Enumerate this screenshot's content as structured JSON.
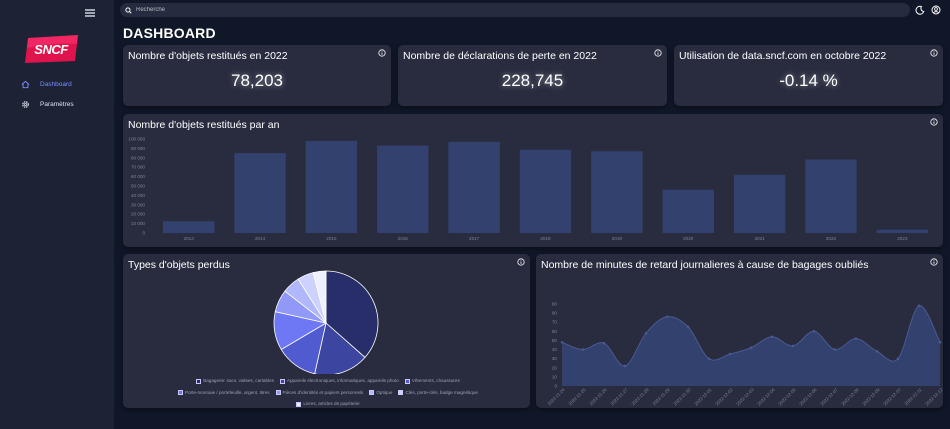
{
  "app": {
    "brand": "SNCF",
    "colors": {
      "accent": "#7b8cff",
      "background": "#101728",
      "sidebar": "#1d2335",
      "card": "#282c3e",
      "bar": "#33416e",
      "line_area": "#33416e",
      "logo_red": "#e0144c"
    }
  },
  "sidebar": {
    "items": [
      {
        "label": "Dashboard",
        "icon": "home-icon",
        "active": true
      },
      {
        "label": "Paramètres",
        "icon": "gear-icon",
        "active": false
      }
    ]
  },
  "search": {
    "placeholder": "Recherche"
  },
  "page": {
    "title": "DASHBOARD"
  },
  "kpis": [
    {
      "title": "Nombre d'objets restitués en 2022",
      "value": "78,203"
    },
    {
      "title": "Nombre de déclarations de perte en 2022",
      "value": "228,745"
    },
    {
      "title": "Utilisation de data.sncf.com en octobre 2022",
      "value": "-0.14 %"
    }
  ],
  "charts": {
    "bar_title": "Nombre d'objets restitués par an",
    "pie_title": "Types d'objets perdus",
    "line_title": "Nombre de minutes de retard journalieres à cause de bagages oubliés"
  },
  "chart_data": [
    {
      "type": "bar",
      "categories": [
        "2013",
        "2014",
        "2015",
        "2016",
        "2017",
        "2018",
        "2019",
        "2020",
        "2021",
        "2022",
        "2023"
      ],
      "values": [
        12500,
        85000,
        98000,
        93000,
        97000,
        88500,
        87000,
        46000,
        62000,
        78203,
        3500
      ],
      "yticks": [
        "0",
        "10 000",
        "20 000",
        "30 000",
        "40 000",
        "50 000",
        "60 000",
        "70 000",
        "80 000",
        "90 000",
        "100 000"
      ],
      "ylim": [
        0,
        100000
      ],
      "grid": false
    },
    {
      "type": "pie",
      "labels": [
        "Bagagerie: sacs, valises, cartables",
        "Appareils électroniques, informatiques, appareils photo",
        "Vêtements, chaussures",
        "Porte-monnaie / portefeuille, argent, titres",
        "Pièces d'identités et papiers personnels",
        "Optique",
        "Clés, porte-clés, badge magnétique",
        "Livres, articles de papèterie"
      ],
      "values": [
        36.5,
        17,
        13,
        12,
        7,
        5.5,
        5,
        4
      ],
      "colors": [
        "#272e6a",
        "#3c46a0",
        "#515bd0",
        "#6e78f5",
        "#9098f8",
        "#b1b7fb",
        "#cdd1fd",
        "#eeefff"
      ],
      "legend": "bottom"
    },
    {
      "type": "area",
      "x": [
        "2022-11-24",
        "2022-11-25",
        "2022-11-26",
        "2022-11-27",
        "2022-11-28",
        "2022-11-29",
        "2022-11-30",
        "2022-12-01",
        "2022-12-02",
        "2022-12-03",
        "2022-12-04",
        "2022-12-05",
        "2022-12-06",
        "2022-12-07",
        "2022-12-08",
        "2022-12-09",
        "2022-12-10",
        "2022-12-11",
        "2022-12-12"
      ],
      "y": [
        48,
        40,
        47,
        22,
        58,
        76,
        65,
        30,
        35,
        42,
        54,
        44,
        60,
        40,
        52,
        38,
        30,
        88,
        48
      ],
      "yticks": [
        "0",
        "10",
        "20",
        "30",
        "40",
        "50",
        "60",
        "70",
        "80",
        "90"
      ],
      "ylim": [
        0,
        90
      ],
      "grid": false
    }
  ]
}
